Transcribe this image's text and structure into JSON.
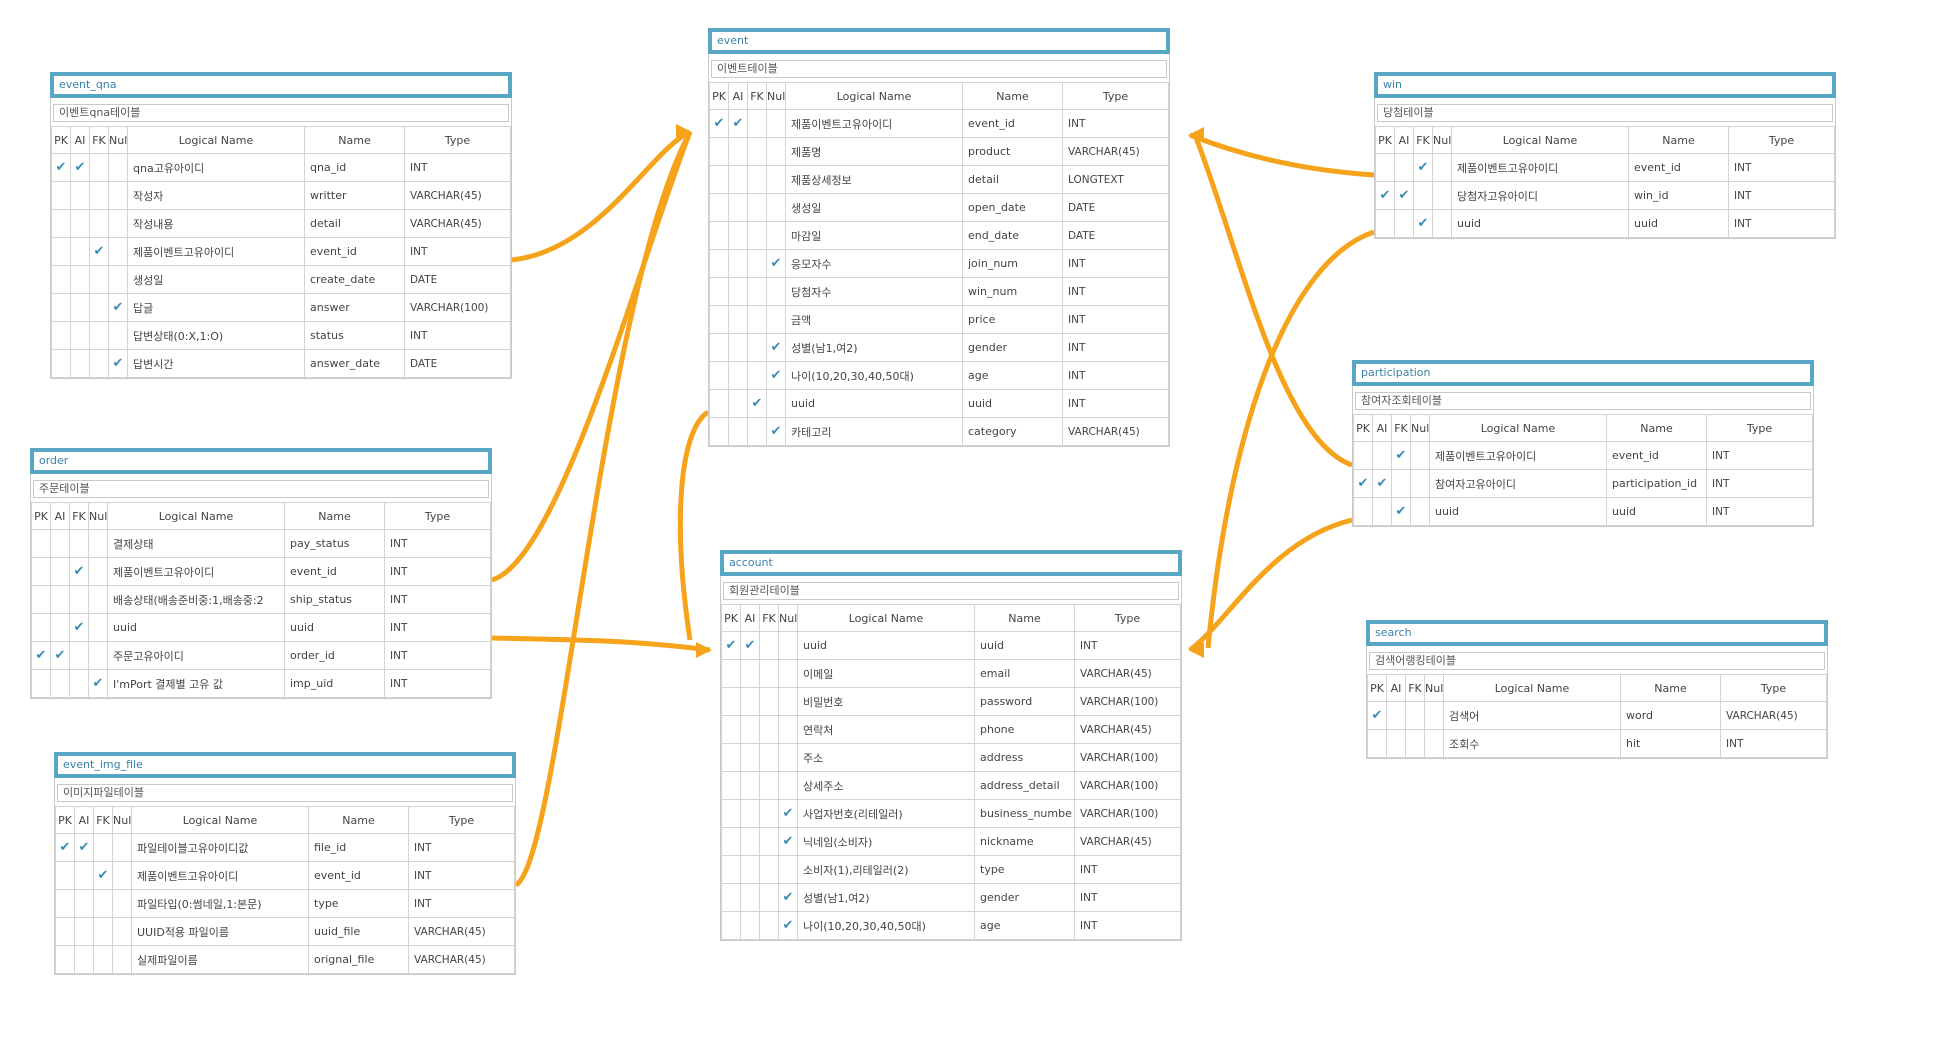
{
  "columns": {
    "pk": "PK",
    "ai": "AI",
    "fk": "FK",
    "null": "Null",
    "logical": "Logical Name",
    "name": "Name",
    "type": "Type"
  },
  "check": "✔",
  "tables": [
    {
      "title": "event_qna",
      "comment": "이벤트qna테이블",
      "rows": [
        {
          "pk": true,
          "ai": true,
          "fk": false,
          "nn": false,
          "logical": "qna고유아이디",
          "name": "qna_id",
          "type": "INT"
        },
        {
          "pk": false,
          "ai": false,
          "fk": false,
          "nn": false,
          "logical": "작성자",
          "name": "writter",
          "type": "VARCHAR(45)"
        },
        {
          "pk": false,
          "ai": false,
          "fk": false,
          "nn": false,
          "logical": "작성내용",
          "name": "detail",
          "type": "VARCHAR(45)"
        },
        {
          "pk": false,
          "ai": false,
          "fk": true,
          "nn": false,
          "logical": "제품이벤트고유아이디",
          "name": "event_id",
          "type": "INT"
        },
        {
          "pk": false,
          "ai": false,
          "fk": false,
          "nn": false,
          "logical": "생성일",
          "name": "create_date",
          "type": "DATE"
        },
        {
          "pk": false,
          "ai": false,
          "fk": false,
          "nn": true,
          "logical": "답글",
          "name": "answer",
          "type": "VARCHAR(100)"
        },
        {
          "pk": false,
          "ai": false,
          "fk": false,
          "nn": false,
          "logical": "답변상태(0:X,1:O)",
          "name": "status",
          "type": "INT"
        },
        {
          "pk": false,
          "ai": false,
          "fk": false,
          "nn": true,
          "logical": "답변시간",
          "name": "answer_date",
          "type": "DATE"
        }
      ]
    },
    {
      "title": "order",
      "comment": "주문테이블",
      "rows": [
        {
          "pk": false,
          "ai": false,
          "fk": false,
          "nn": false,
          "logical": "결제상태",
          "name": "pay_status",
          "type": "INT"
        },
        {
          "pk": false,
          "ai": false,
          "fk": true,
          "nn": false,
          "logical": "제품이벤트고유아이디",
          "name": "event_id",
          "type": "INT"
        },
        {
          "pk": false,
          "ai": false,
          "fk": false,
          "nn": false,
          "logical": "배송상태(배송준비중:1,배송중:2",
          "name": "ship_status",
          "type": "INT"
        },
        {
          "pk": false,
          "ai": false,
          "fk": true,
          "nn": false,
          "logical": "uuid",
          "name": "uuid",
          "type": "INT"
        },
        {
          "pk": true,
          "ai": true,
          "fk": false,
          "nn": false,
          "logical": "주문고유아이디",
          "name": "order_id",
          "type": "INT"
        },
        {
          "pk": false,
          "ai": false,
          "fk": false,
          "nn": true,
          "logical": "I'mPort 결제별 고유 값",
          "name": "imp_uid",
          "type": "INT"
        }
      ]
    },
    {
      "title": "event_img_file",
      "comment": "이미지파일테이블",
      "rows": [
        {
          "pk": true,
          "ai": true,
          "fk": false,
          "nn": false,
          "logical": "파일테이블고유아이디값",
          "name": "file_id",
          "type": "INT"
        },
        {
          "pk": false,
          "ai": false,
          "fk": true,
          "nn": false,
          "logical": "제품이벤트고유아이디",
          "name": "event_id",
          "type": "INT"
        },
        {
          "pk": false,
          "ai": false,
          "fk": false,
          "nn": false,
          "logical": "파일타입(0:썸네일,1:본문)",
          "name": "type",
          "type": "INT"
        },
        {
          "pk": false,
          "ai": false,
          "fk": false,
          "nn": false,
          "logical": "UUID적용 파일이름",
          "name": "uuid_file",
          "type": "VARCHAR(45)"
        },
        {
          "pk": false,
          "ai": false,
          "fk": false,
          "nn": false,
          "logical": "실제파일이름",
          "name": "orignal_file",
          "type": "VARCHAR(45)"
        }
      ]
    },
    {
      "title": "event",
      "comment": "이벤트테이블",
      "rows": [
        {
          "pk": true,
          "ai": true,
          "fk": false,
          "nn": false,
          "logical": "제품이벤트고유아이디",
          "name": "event_id",
          "type": "INT"
        },
        {
          "pk": false,
          "ai": false,
          "fk": false,
          "nn": false,
          "logical": "제품명",
          "name": "product",
          "type": "VARCHAR(45)"
        },
        {
          "pk": false,
          "ai": false,
          "fk": false,
          "nn": false,
          "logical": "제품상세정보",
          "name": "detail",
          "type": "LONGTEXT"
        },
        {
          "pk": false,
          "ai": false,
          "fk": false,
          "nn": false,
          "logical": "생성일",
          "name": "open_date",
          "type": "DATE"
        },
        {
          "pk": false,
          "ai": false,
          "fk": false,
          "nn": false,
          "logical": "마감일",
          "name": "end_date",
          "type": "DATE"
        },
        {
          "pk": false,
          "ai": false,
          "fk": false,
          "nn": true,
          "logical": "응모자수",
          "name": "join_num",
          "type": "INT"
        },
        {
          "pk": false,
          "ai": false,
          "fk": false,
          "nn": false,
          "logical": "당첨자수",
          "name": "win_num",
          "type": "INT"
        },
        {
          "pk": false,
          "ai": false,
          "fk": false,
          "nn": false,
          "logical": "금액",
          "name": "price",
          "type": "INT"
        },
        {
          "pk": false,
          "ai": false,
          "fk": false,
          "nn": true,
          "logical": "성별(남1,여2)",
          "name": "gender",
          "type": "INT"
        },
        {
          "pk": false,
          "ai": false,
          "fk": false,
          "nn": true,
          "logical": "나이(10,20,30,40,50대)",
          "name": "age",
          "type": "INT"
        },
        {
          "pk": false,
          "ai": false,
          "fk": true,
          "nn": false,
          "logical": "uuid",
          "name": "uuid",
          "type": "INT"
        },
        {
          "pk": false,
          "ai": false,
          "fk": false,
          "nn": true,
          "logical": "카테고리",
          "name": "category",
          "type": "VARCHAR(45)"
        }
      ]
    },
    {
      "title": "account",
      "comment": "회원관리테이블",
      "rows": [
        {
          "pk": true,
          "ai": true,
          "fk": false,
          "nn": false,
          "logical": "uuid",
          "name": "uuid",
          "type": "INT"
        },
        {
          "pk": false,
          "ai": false,
          "fk": false,
          "nn": false,
          "logical": "이메일",
          "name": "email",
          "type": "VARCHAR(45)"
        },
        {
          "pk": false,
          "ai": false,
          "fk": false,
          "nn": false,
          "logical": "비밀번호",
          "name": "password",
          "type": "VARCHAR(100)"
        },
        {
          "pk": false,
          "ai": false,
          "fk": false,
          "nn": false,
          "logical": "연락처",
          "name": "phone",
          "type": "VARCHAR(45)"
        },
        {
          "pk": false,
          "ai": false,
          "fk": false,
          "nn": false,
          "logical": "주소",
          "name": "address",
          "type": "VARCHAR(100)"
        },
        {
          "pk": false,
          "ai": false,
          "fk": false,
          "nn": false,
          "logical": "상세주소",
          "name": "address_detail",
          "type": "VARCHAR(100)"
        },
        {
          "pk": false,
          "ai": false,
          "fk": false,
          "nn": true,
          "logical": "사업자번호(리테일러)",
          "name": "business_numbe",
          "type": "VARCHAR(100)"
        },
        {
          "pk": false,
          "ai": false,
          "fk": false,
          "nn": true,
          "logical": "닉네임(소비자)",
          "name": "nickname",
          "type": "VARCHAR(45)"
        },
        {
          "pk": false,
          "ai": false,
          "fk": false,
          "nn": false,
          "logical": "소비자(1),리테일러(2)",
          "name": "type",
          "type": "INT"
        },
        {
          "pk": false,
          "ai": false,
          "fk": false,
          "nn": true,
          "logical": "성별(남1,여2)",
          "name": "gender",
          "type": "INT"
        },
        {
          "pk": false,
          "ai": false,
          "fk": false,
          "nn": true,
          "logical": "나이(10,20,30,40,50대)",
          "name": "age",
          "type": "INT"
        }
      ]
    },
    {
      "title": "win",
      "comment": "당첨테이블",
      "rows": [
        {
          "pk": false,
          "ai": false,
          "fk": true,
          "nn": false,
          "logical": "제품이벤트고유아이디",
          "name": "event_id",
          "type": "INT"
        },
        {
          "pk": true,
          "ai": true,
          "fk": false,
          "nn": false,
          "logical": "당첨자고유아이디",
          "name": "win_id",
          "type": "INT"
        },
        {
          "pk": false,
          "ai": false,
          "fk": true,
          "nn": false,
          "logical": "uuid",
          "name": "uuid",
          "type": "INT"
        }
      ]
    },
    {
      "title": "participation",
      "comment": "참여자조회테이블",
      "rows": [
        {
          "pk": false,
          "ai": false,
          "fk": true,
          "nn": false,
          "logical": "제품이벤트고유아이디",
          "name": "event_id",
          "type": "INT"
        },
        {
          "pk": true,
          "ai": true,
          "fk": false,
          "nn": false,
          "logical": "참여자고유아이디",
          "name": "participation_id",
          "type": "INT"
        },
        {
          "pk": false,
          "ai": false,
          "fk": true,
          "nn": false,
          "logical": "uuid",
          "name": "uuid",
          "type": "INT"
        }
      ]
    },
    {
      "title": "search",
      "comment": "검색어랭킹테이블",
      "rows": [
        {
          "pk": true,
          "ai": false,
          "fk": false,
          "nn": false,
          "logical": "검색어",
          "name": "word",
          "type": "VARCHAR(45)"
        },
        {
          "pk": false,
          "ai": false,
          "fk": false,
          "nn": false,
          "logical": "조회수",
          "name": "hit",
          "type": "INT"
        }
      ]
    }
  ],
  "colors": {
    "relation": "#f5a31a",
    "header_border": "#57a6c4",
    "header_text": "#3a82a8"
  }
}
